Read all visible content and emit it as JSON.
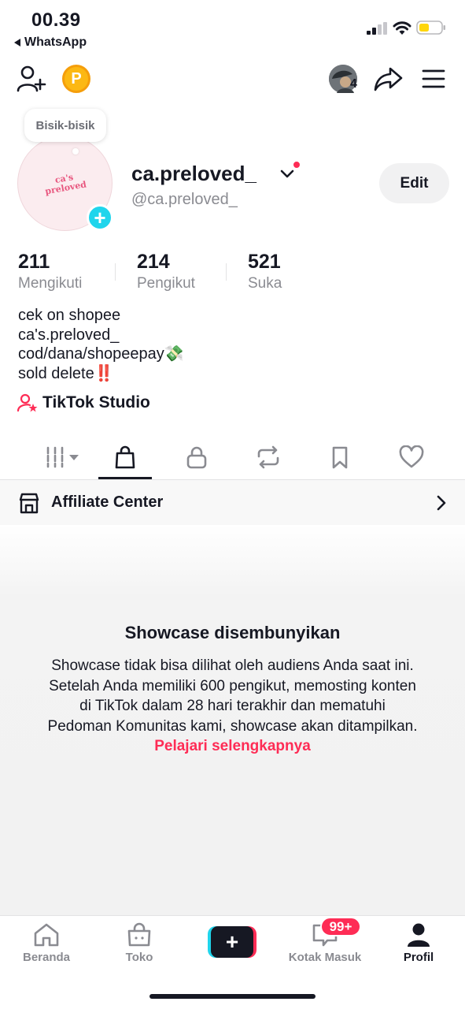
{
  "status_bar": {
    "time": "00.39",
    "back_app": "WhatsApp"
  },
  "toolbar": {
    "coin_letter": "P",
    "friends_count": "4"
  },
  "tooltip": "Bisik-bisik",
  "profile": {
    "avatar_logo_line1": "ca's",
    "avatar_logo_line2": "preloved",
    "username": "ca.preloved_",
    "handle": "@ca.preloved_",
    "edit_label": "Edit"
  },
  "stats": [
    {
      "value": "211",
      "label": "Mengikuti"
    },
    {
      "value": "214",
      "label": "Pengikut"
    },
    {
      "value": "521",
      "label": "Suka"
    }
  ],
  "bio": [
    "cek on shopee",
    "ca's.preloved_",
    "cod/dana/shopeepay💸",
    "sold delete‼️"
  ],
  "studio_label": "TikTok Studio",
  "affiliate_label": "Affiliate Center",
  "empty_state": {
    "title": "Showcase disembunyikan",
    "body": "Showcase tidak bisa dilihat oleh audiens Anda saat ini. Setelah Anda memiliki 600 pengikut, memosting konten di TikTok dalam 28 hari terakhir dan mematuhi Pedoman Komunitas kami, showcase akan ditampilkan.",
    "link": "Pelajari selengkapnya"
  },
  "bottom_nav": {
    "home": "Beranda",
    "shop": "Toko",
    "inbox": "Kotak Masuk",
    "inbox_badge": "99+",
    "profile": "Profil"
  },
  "colors": {
    "accent": "#fe2c55",
    "cyan": "#20d5ec",
    "text": "#161823",
    "muted": "#8a8b91",
    "coin": "#fcb813"
  }
}
